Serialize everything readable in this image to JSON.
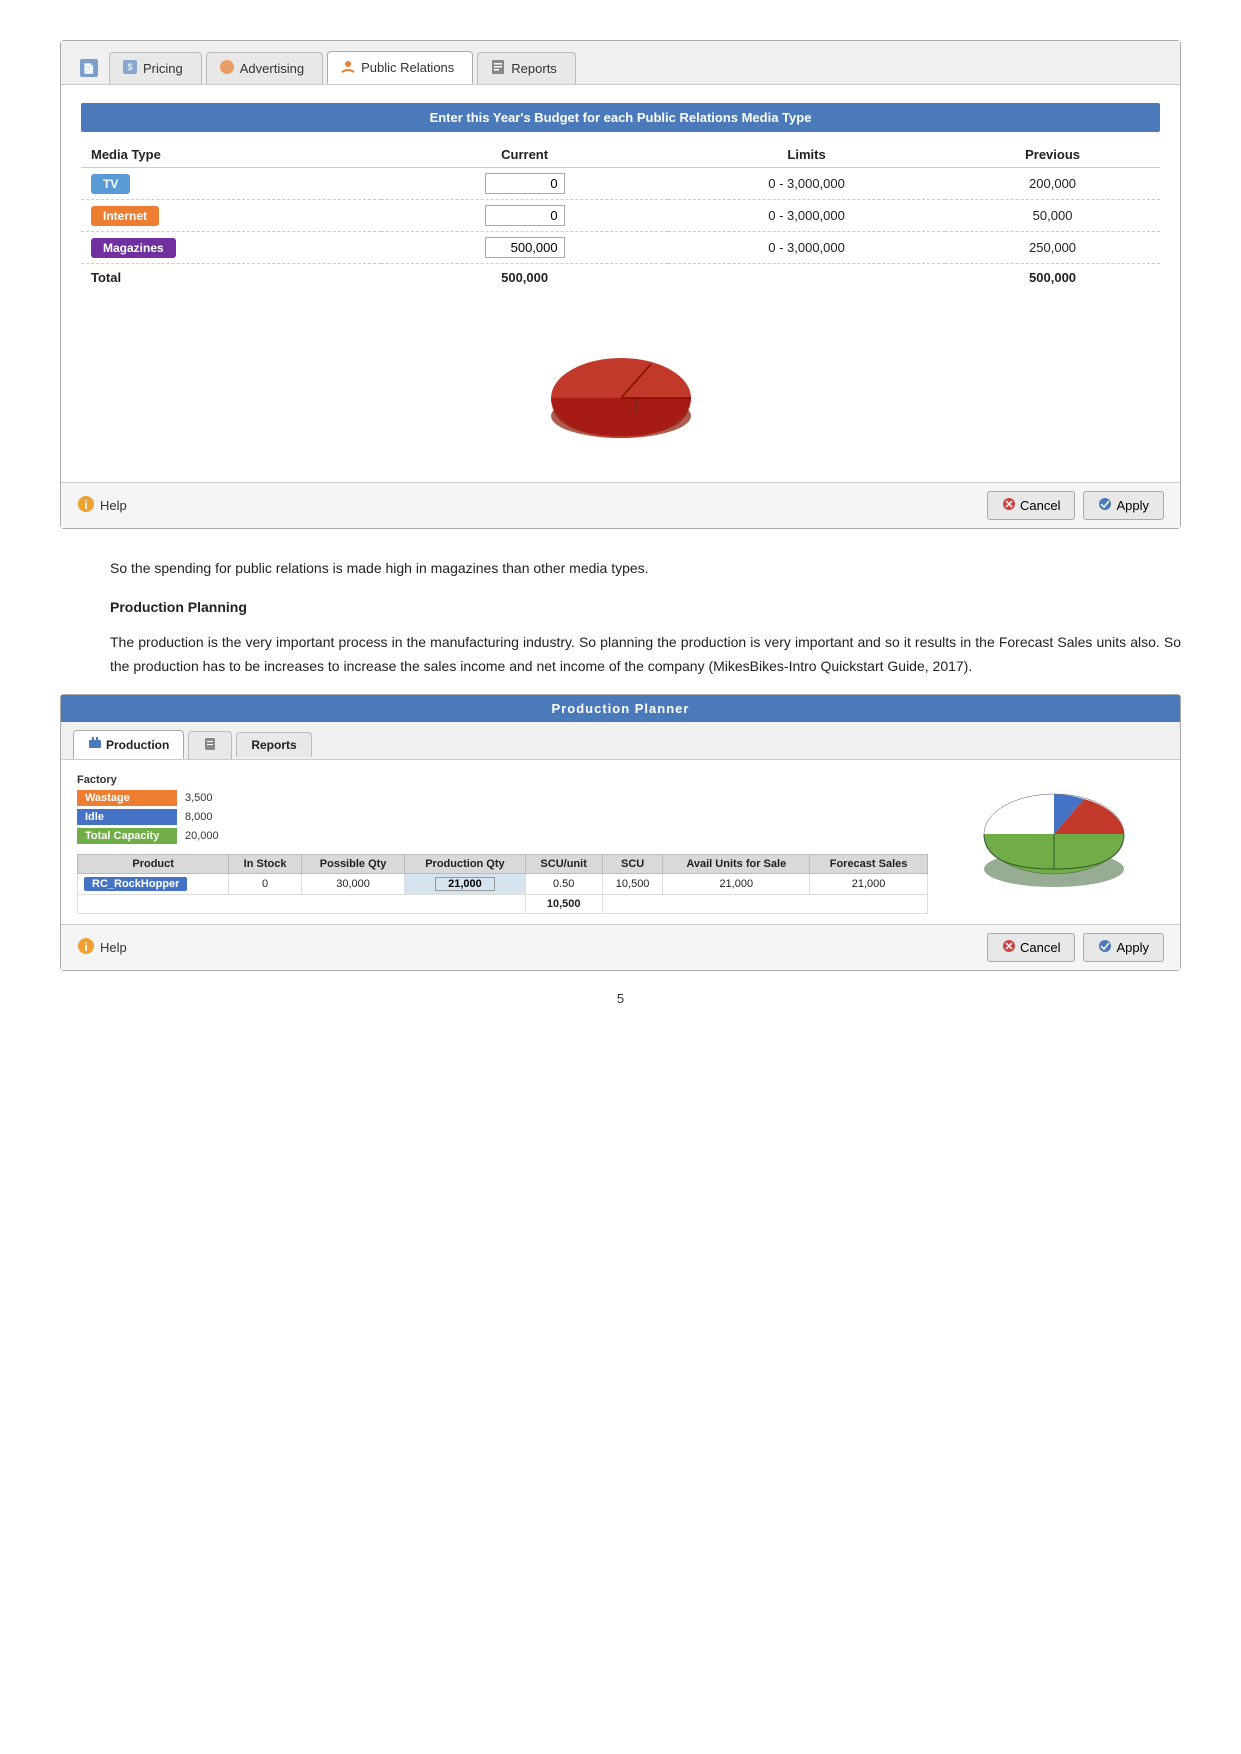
{
  "pr_panel": {
    "tabs": [
      {
        "id": "pricing",
        "label": "Pricing",
        "icon": "📄",
        "active": false
      },
      {
        "id": "advertising",
        "label": "Advertising",
        "icon": "🎨",
        "active": false
      },
      {
        "id": "public_relations",
        "label": "Public Relations",
        "icon": "🤝",
        "active": true
      },
      {
        "id": "reports",
        "label": "Reports",
        "icon": "📋",
        "active": false
      }
    ],
    "section_header": "Enter this Year's Budget for each Public Relations Media Type",
    "table": {
      "columns": [
        "Media Type",
        "Current",
        "Limits",
        "Previous"
      ],
      "rows": [
        {
          "media": "TV",
          "badge_class": "badge-tv",
          "current": "0",
          "limits": "0 - 3,000,000",
          "previous": "200,000"
        },
        {
          "media": "Internet",
          "badge_class": "badge-internet",
          "current": "0",
          "limits": "0 - 3,000,000",
          "previous": "50,000"
        },
        {
          "media": "Magazines",
          "badge_class": "badge-magazines",
          "current": "500,000",
          "limits": "0 - 3,000,000",
          "previous": "250,000"
        }
      ],
      "total_label": "Total",
      "total_current": "500,000",
      "total_previous": "500,000"
    },
    "buttons": {
      "help": "Help",
      "cancel": "Cancel",
      "apply": "Apply"
    }
  },
  "paragraph1": "So the spending for public relations is made high in magazines than other media types.",
  "section2_title": "Production Planning",
  "paragraph2": "The production is the very important process in the manufacturing industry. So planning the production is very important and so it results in the Forecast Sales units also. So the production has to be increases to increase the sales income and net income of the company (MikesBikes-Intro Quickstart Guide, 2017).",
  "prod_panel": {
    "header": "Production Planner",
    "tabs": [
      {
        "id": "production",
        "label": "Production",
        "icon": "🏭",
        "active": true
      },
      {
        "id": "notes",
        "label": "",
        "icon": "📝",
        "active": false
      },
      {
        "id": "reports",
        "label": "Reports",
        "active": false
      }
    ],
    "factory": {
      "label": "Factory",
      "rows": [
        {
          "label": "Wastage",
          "bar_class": "bar-wastage",
          "value": "3,500"
        },
        {
          "label": "Idle",
          "bar_class": "bar-idle",
          "value": "8,000"
        },
        {
          "label": "Total Capacity",
          "bar_class": "bar-total",
          "value": "20,000"
        }
      ]
    },
    "table": {
      "columns": [
        "Product",
        "In Stock",
        "Possible Qty",
        "Production Qty",
        "SCU/unit",
        "SCU",
        "Avail Units for Sale",
        "Forecast Sales"
      ],
      "rows": [
        {
          "product": "RC_RockHopper",
          "badge_class": "prod-badge-blue",
          "in_stock": "0",
          "possible_qty": "30,000",
          "production_qty": "21,000",
          "scu_unit": "0.50",
          "scu": "10,500",
          "avail": "21,000",
          "forecast": "21,000"
        }
      ],
      "total_scu": "10,500"
    },
    "buttons": {
      "help": "Help",
      "cancel": "Cancel",
      "apply": "Apply"
    }
  },
  "page_number": "5"
}
